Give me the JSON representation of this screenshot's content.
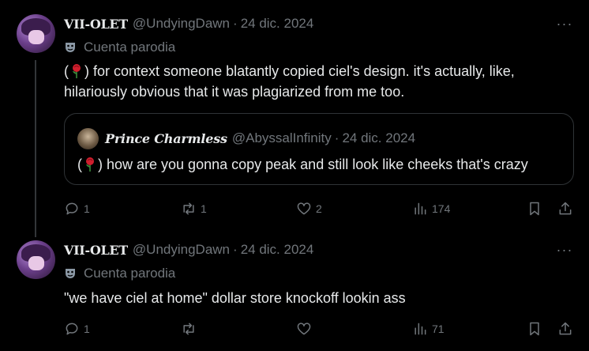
{
  "tweets": [
    {
      "display_name": "VII-OLET",
      "handle": "@UndyingDawn",
      "separator": "·",
      "date": "24 dic. 2024",
      "badge_label": "Cuenta parodia",
      "text_prefix": "(",
      "text_line1_rest": ") for context someone blatantly copied ciel's design. it's actually, like,",
      "text_line2": "hilariously obvious that it was plagiarized from me too.",
      "more": "···",
      "replies": "1",
      "reposts": "1",
      "likes": "2",
      "views": "174"
    },
    {
      "display_name": "VII-OLET",
      "handle": "@UndyingDawn",
      "separator": "·",
      "date": "24 dic. 2024",
      "badge_label": "Cuenta parodia",
      "text": "\"we have ciel at home\" dollar store knockoff lookin ass",
      "more": "···",
      "replies": "1",
      "reposts": "",
      "likes": "",
      "views": "71"
    }
  ],
  "quote": {
    "display_name": "Prince Charmless",
    "handle": "@AbyssalInfinity",
    "separator": "·",
    "date": "24 dic. 2024",
    "text_prefix": "(",
    "text_rest": ") how are you gonna copy peak and still look like cheeks that's crazy"
  },
  "icons": {
    "reply": "reply-icon",
    "repost": "repost-icon",
    "like": "heart-icon",
    "views": "views-icon",
    "bookmark": "bookmark-icon",
    "share": "share-icon",
    "rose": "rose-emoji-icon",
    "parody": "parody-mask-icon"
  },
  "colors": {
    "background": "#000000",
    "text": "#e7e9ea",
    "muted": "#71767b",
    "border": "#2f3336"
  }
}
